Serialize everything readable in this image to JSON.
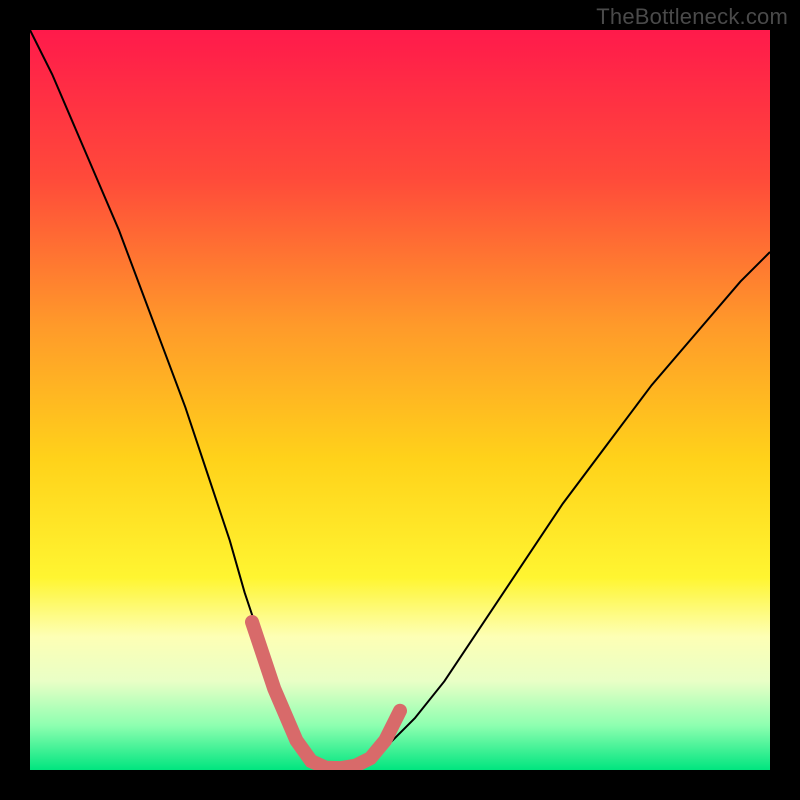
{
  "watermark": {
    "text": "TheBottleneck.com"
  },
  "chart_data": {
    "type": "line",
    "title": "",
    "xlabel": "",
    "ylabel": "",
    "xlim": [
      0,
      100
    ],
    "ylim": [
      0,
      100
    ],
    "grid": false,
    "legend": false,
    "background_gradient_stops": [
      {
        "pos": 0.0,
        "color": "#ff1a4b"
      },
      {
        "pos": 0.2,
        "color": "#ff4a3a"
      },
      {
        "pos": 0.4,
        "color": "#ff9a2a"
      },
      {
        "pos": 0.58,
        "color": "#ffd21a"
      },
      {
        "pos": 0.74,
        "color": "#fff531"
      },
      {
        "pos": 0.82,
        "color": "#fdffb5"
      },
      {
        "pos": 0.88,
        "color": "#e9ffc6"
      },
      {
        "pos": 0.94,
        "color": "#8dffb0"
      },
      {
        "pos": 1.0,
        "color": "#00e57f"
      }
    ],
    "series": [
      {
        "name": "bottleneck-curve",
        "stroke": "#000000",
        "stroke_width": 2,
        "x": [
          0,
          3,
          6,
          9,
          12,
          15,
          18,
          21,
          24,
          27,
          29,
          31,
          33,
          35,
          36.5,
          38,
          40,
          42,
          44,
          46,
          48,
          52,
          56,
          60,
          66,
          72,
          78,
          84,
          90,
          96,
          100
        ],
        "y": [
          100,
          94,
          87,
          80,
          73,
          65,
          57,
          49,
          40,
          31,
          24,
          18,
          12,
          7,
          3.5,
          1.2,
          0.3,
          0.2,
          0.5,
          1.4,
          3,
          7,
          12,
          18,
          27,
          36,
          44,
          52,
          59,
          66,
          70
        ]
      },
      {
        "name": "highlight-valley",
        "stroke": "#d86a6a",
        "stroke_width": 14,
        "linecap": "round",
        "x": [
          30,
          33,
          36,
          38,
          40,
          42,
          44,
          46,
          48,
          50
        ],
        "y": [
          20,
          11,
          4,
          1.2,
          0.3,
          0.25,
          0.6,
          1.6,
          4,
          8
        ]
      }
    ],
    "annotations": []
  }
}
